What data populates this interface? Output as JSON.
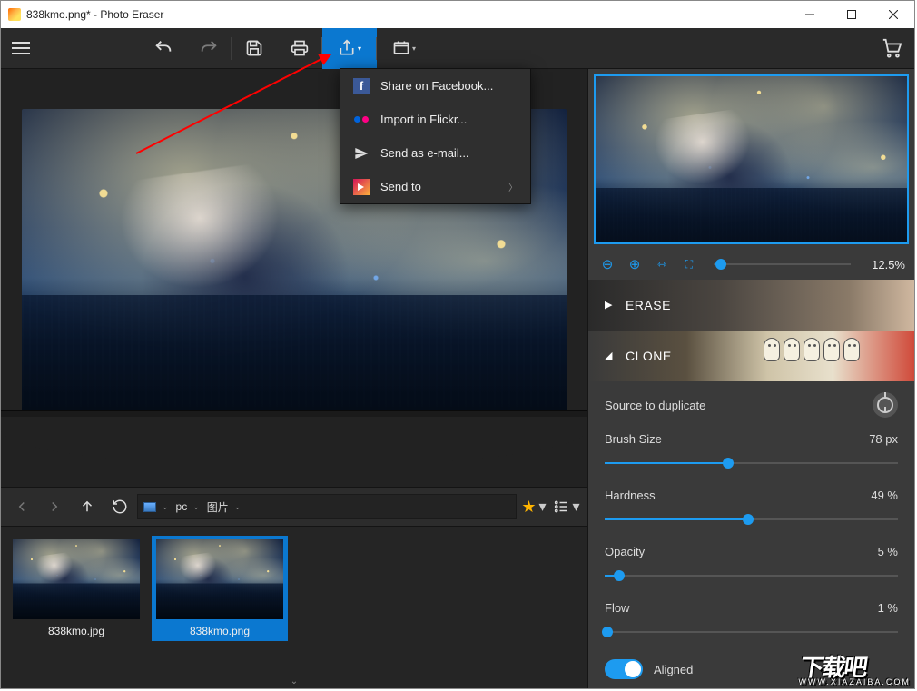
{
  "window": {
    "title": "838kmo.png* - Photo Eraser"
  },
  "share_menu": {
    "facebook": "Share on Facebook...",
    "flickr": "Import in Flickr...",
    "email": "Send as e-mail...",
    "sendto": "Send to"
  },
  "path": {
    "seg1": "pc",
    "seg2": "图片"
  },
  "thumbs": {
    "t1": "838kmo.jpg",
    "t2": "838kmo.png"
  },
  "zoom": {
    "value": "12.5%"
  },
  "sections": {
    "erase": "ERASE",
    "clone": "CLONE"
  },
  "clone": {
    "source_label": "Source to duplicate",
    "brush_label": "Brush Size",
    "brush_val": "78 px",
    "brush_pct": 42,
    "hard_label": "Hardness",
    "hard_val": "49 %",
    "hard_pct": 49,
    "opac_label": "Opacity",
    "opac_val": "5 %",
    "opac_pct": 5,
    "flow_label": "Flow",
    "flow_val": "1 %",
    "flow_pct": 1,
    "aligned": "Aligned"
  },
  "watermark": {
    "big": "下载吧",
    "small": "WWW.XIAZAIBA.COM"
  }
}
